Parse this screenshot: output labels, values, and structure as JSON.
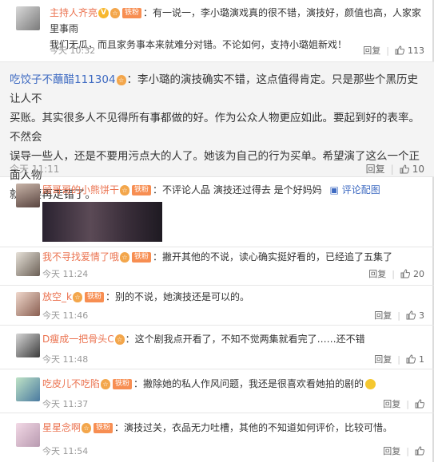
{
  "actions": {
    "reply": "回复"
  },
  "colors": {
    "username": "#eb7350",
    "badge": "#f78e52",
    "time": "#999999"
  },
  "comments": [
    {
      "user": "主持人齐亮",
      "sep": "：",
      "badge": "铁粉",
      "text1": "有一说一，李小璐演戏真的很不错，演技好，颜值也高，人家家里事雨",
      "text2": "我们无瓜，而且家务事本来就难分对错。不论如何，支持小璐姐新戏！",
      "time": "今天 10:32",
      "likes": "113"
    },
    {
      "user": "吃饺子不蘸醋111304",
      "sep": "：",
      "text1": "李小璐的演技确实不错，这点值得肯定。只是那些个黑历史让人不",
      "text2": "买账。其实很多人不见得所有事都做的好。作为公众人物更应如此。要起到好的表率。不然会",
      "text3": "误导一些人，还是不要用污点大的人了。她该为自己的行为买单。希望演了这么一个正面人物",
      "text4": "就不要再走错了。",
      "time": "今天 11:11",
      "likes": "10"
    },
    {
      "user": "顾哥哥的小熊饼干",
      "sep": "：",
      "badge": "铁粉",
      "text1": "不评论人品  演技还过得去  是个好妈妈",
      "view_image": "评论配图"
    },
    {
      "user": "我不寻找爱情了哦",
      "sep": "：",
      "badge": "铁粉",
      "text1": "撇开其他的不说，读心确实挺好看的，已经追了五集了",
      "time": "今天 11:24",
      "likes": "20"
    },
    {
      "user": "放空_k",
      "sep": "：",
      "badge": "铁粉",
      "text1": "别的不说，她演技还是可以的。",
      "time": "今天 11:46",
      "likes": "3"
    },
    {
      "user": "D瘦成一把骨头C",
      "sep": "：",
      "text1": "这个剧我点开看了，不知不觉两集就看完了……还不错",
      "time": "今天 11:48",
      "likes": "1"
    },
    {
      "user": "吃皮儿不吃陷",
      "sep": "：",
      "badge": "铁粉",
      "text1": "撇除她的私人作风问题，我还是很喜欢看她拍的剧的",
      "time": "今天 11:37",
      "likes": ""
    },
    {
      "user": "星星念啊",
      "sep": "：",
      "badge": "铁粉",
      "text1": "演技过关，衣品无力吐槽，其他的不知道如何评价，比较可惜。",
      "time": "今天 11:54",
      "likes": ""
    }
  ]
}
